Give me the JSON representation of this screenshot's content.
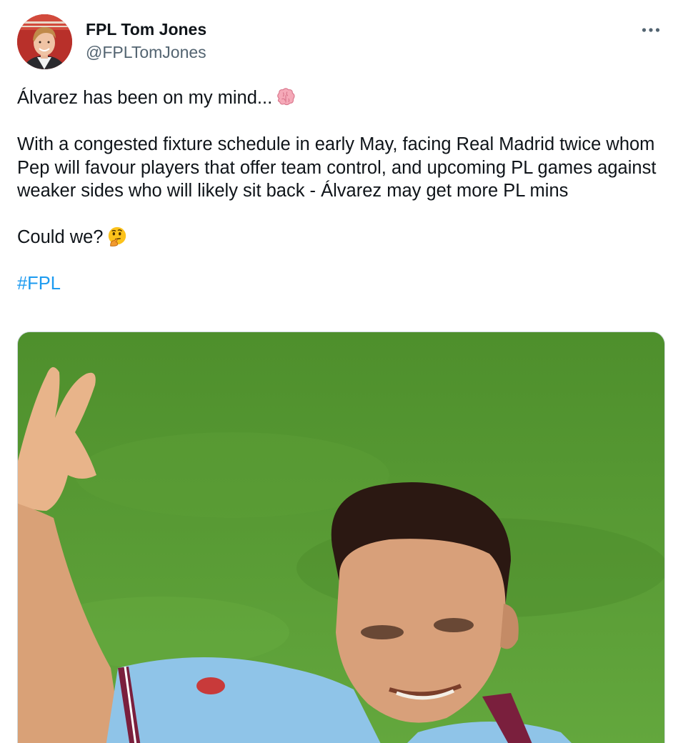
{
  "author": {
    "display_name": "FPL Tom Jones",
    "handle": "@FPLTomJones",
    "avatar_icon": "profile-photo"
  },
  "more_menu": {
    "icon": "more-horizontal-icon"
  },
  "tweet": {
    "line_1": "Álvarez has been on my mind...",
    "line_1_emoji": "brain-emoji",
    "paragraph_2": "With a congested fixture schedule in early May, facing Real Madrid twice whom Pep will favour players that offer team control, and upcoming PL games against weaker sides who will likely sit back - Álvarez may get more PL mins",
    "line_3": "Could we?",
    "line_3_emoji": "thinking-face-emoji",
    "hashtag": "#FPL"
  },
  "media": {
    "kind": "photo",
    "subject": "footballer-waving-photo"
  },
  "colors": {
    "text": "#0f1419",
    "secondary_text": "#536471",
    "link": "#1d9bf0",
    "border": "#cfd9de"
  }
}
